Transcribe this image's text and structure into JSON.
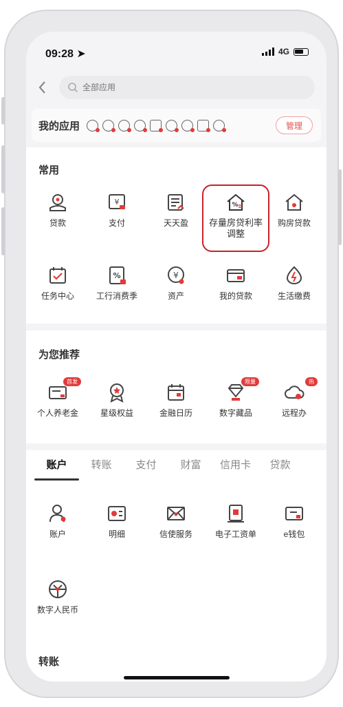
{
  "status": {
    "time": "09:28",
    "network": "4G"
  },
  "search": {
    "placeholder": "全部应用"
  },
  "my_apps": {
    "title": "我的应用",
    "manage_label": "管理"
  },
  "common": {
    "title": "常用",
    "items": [
      {
        "label": "贷款",
        "icon": "loan-icon"
      },
      {
        "label": "支付",
        "icon": "payment-icon"
      },
      {
        "label": "天天盈",
        "icon": "daily-earn-icon"
      },
      {
        "label": "存量房贷利率调整",
        "label_line1": "存量房贷利率",
        "label_line2": "调整",
        "icon": "mortgage-rate-icon"
      },
      {
        "label": "购房贷款",
        "icon": "home-loan-icon"
      },
      {
        "label": "任务中心",
        "icon": "task-center-icon"
      },
      {
        "label": "工行消费季",
        "icon": "consumption-icon"
      },
      {
        "label": "资产",
        "icon": "assets-icon"
      },
      {
        "label": "我的贷款",
        "icon": "my-loans-icon"
      },
      {
        "label": "生活缴费",
        "icon": "utility-icon"
      }
    ]
  },
  "recommended": {
    "title": "为您推荐",
    "items": [
      {
        "label": "个人养老金",
        "badge": "首发",
        "icon": "pension-icon"
      },
      {
        "label": "星级权益",
        "badge": "",
        "icon": "star-rights-icon"
      },
      {
        "label": "金融日历",
        "badge": "",
        "icon": "finance-calendar-icon"
      },
      {
        "label": "数字藏品",
        "badge": "限量",
        "icon": "digital-collection-icon"
      },
      {
        "label": "远程办",
        "badge": "热",
        "icon": "remote-service-icon"
      }
    ]
  },
  "tabs": [
    "账户",
    "转账",
    "支付",
    "财富",
    "信用卡",
    "贷款"
  ],
  "account": {
    "items": [
      {
        "label": "账户",
        "icon": "account-icon"
      },
      {
        "label": "明细",
        "icon": "details-icon"
      },
      {
        "label": "信使服务",
        "icon": "messenger-icon"
      },
      {
        "label": "电子工资单",
        "icon": "payslip-icon"
      },
      {
        "label": "e钱包",
        "icon": "e-wallet-icon"
      },
      {
        "label": "数字人民币",
        "icon": "digital-rmb-icon"
      }
    ]
  },
  "transfer_section": {
    "title": "转账"
  },
  "colors": {
    "accent": "#e23a3a",
    "highlight_border": "#c8202c"
  }
}
